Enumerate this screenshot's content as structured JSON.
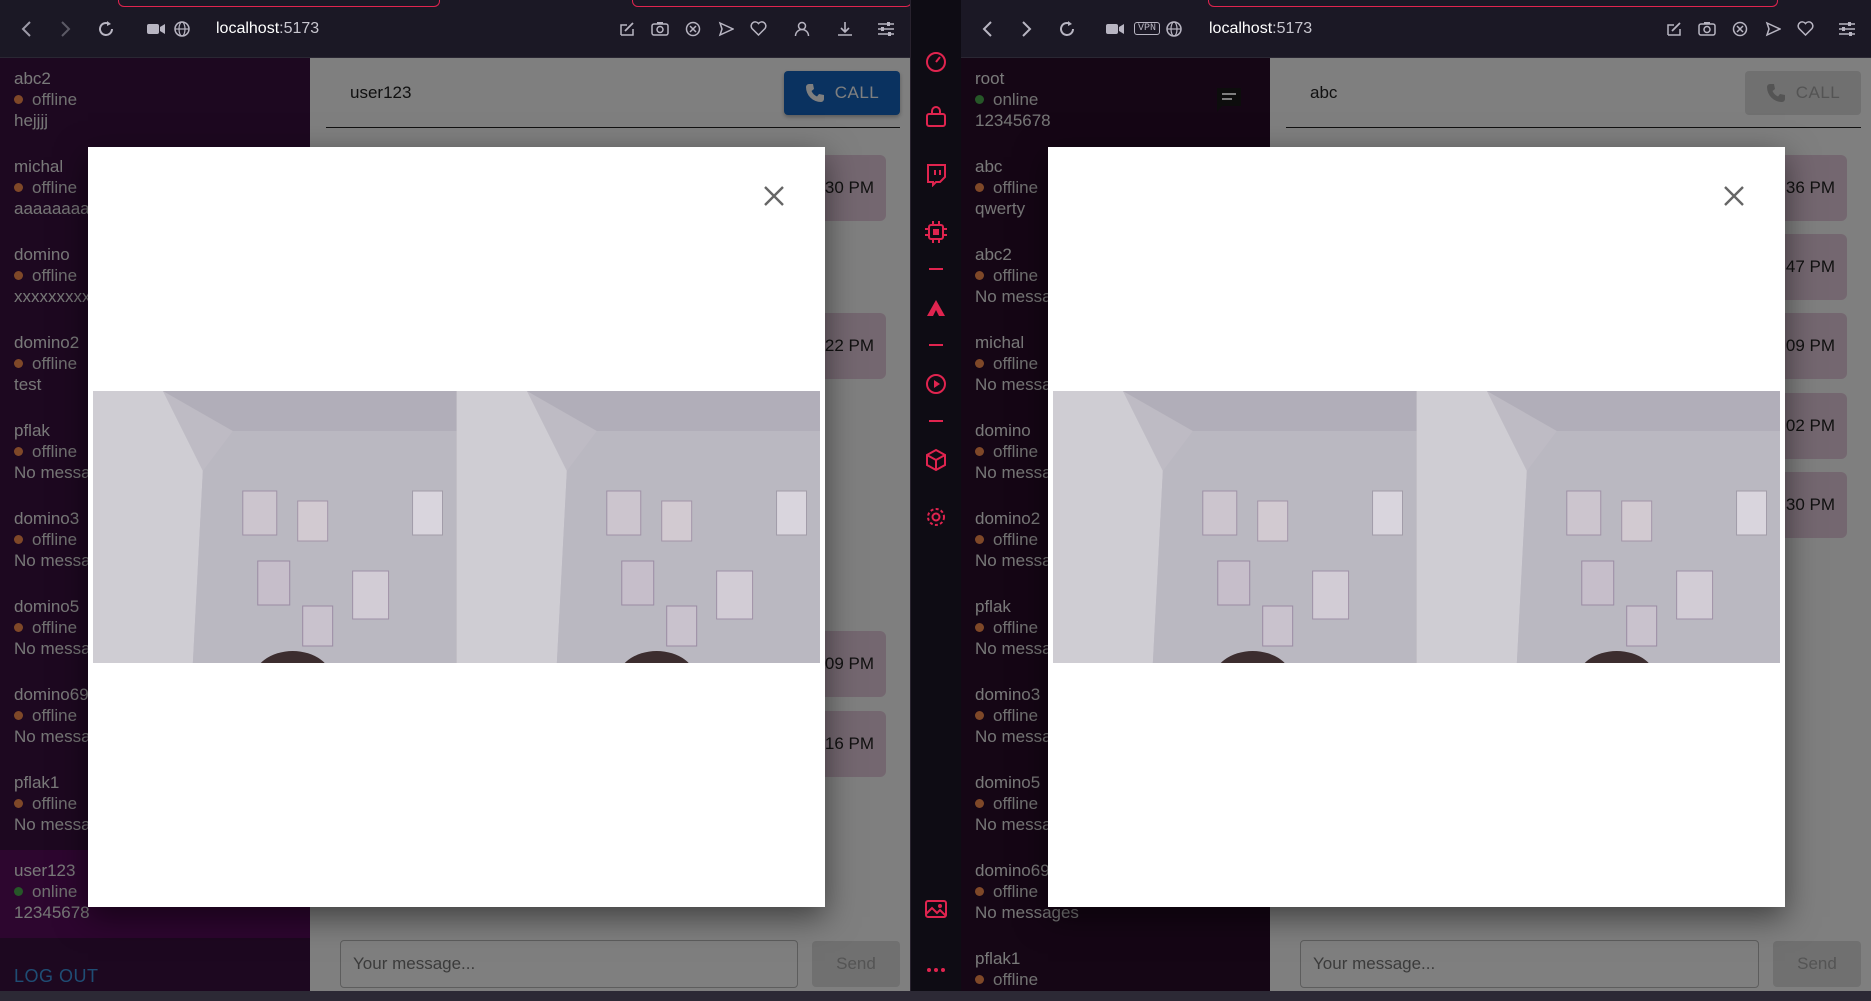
{
  "colors": {
    "accent": "#e0244f",
    "call": "#1565c0",
    "logout": "#3f9ae8",
    "bubble": "#e9cfe0",
    "online": "#4caf50",
    "offline": "#ff9050"
  },
  "left": {
    "url_host": "localhost",
    "url_port": ":5173",
    "contacts": [
      {
        "name": "abc2",
        "status": "offline",
        "last": "hejjjj"
      },
      {
        "name": "michal",
        "status": "offline",
        "last": "aaaaaaaaa"
      },
      {
        "name": "domino",
        "status": "offline",
        "last": "xxxxxxxxx"
      },
      {
        "name": "domino2",
        "status": "offline",
        "last": "test"
      },
      {
        "name": "pflak",
        "status": "offline",
        "last": "No messa"
      },
      {
        "name": "domino3",
        "status": "offline",
        "last": "No messa"
      },
      {
        "name": "domino5",
        "status": "offline",
        "last": "No messa"
      },
      {
        "name": "domino69",
        "status": "offline",
        "last": "No messa"
      },
      {
        "name": "pflak1",
        "status": "offline",
        "last": "No messa"
      },
      {
        "name": "user123",
        "status": "online",
        "last": "12345678"
      }
    ],
    "logout": "LOG OUT",
    "chat_title": "user123",
    "call_label": "CALL",
    "times": [
      "30 PM",
      "22 PM",
      "09 PM",
      "16 PM"
    ],
    "message_placeholder": "Your message...",
    "send_label": "Send"
  },
  "right": {
    "url_host": "localhost",
    "url_port": ":5173",
    "vpn": "VPN",
    "contacts": [
      {
        "name": "root",
        "status": "online",
        "last": "12345678"
      },
      {
        "name": "abc",
        "status": "offline",
        "last": "qwerty"
      },
      {
        "name": "abc2",
        "status": "offline",
        "last": "No messa"
      },
      {
        "name": "michal",
        "status": "offline",
        "last": "No messa"
      },
      {
        "name": "domino",
        "status": "offline",
        "last": "No messa"
      },
      {
        "name": "domino2",
        "status": "offline",
        "last": "No messa"
      },
      {
        "name": "pflak",
        "status": "offline",
        "last": "No messa"
      },
      {
        "name": "domino3",
        "status": "offline",
        "last": "No messa"
      },
      {
        "name": "domino5",
        "status": "offline",
        "last": "No messa"
      },
      {
        "name": "domino69",
        "status": "offline",
        "last": "No messages"
      },
      {
        "name": "pflak1",
        "status": "offline",
        "last": ""
      }
    ],
    "chat_title": "abc",
    "call_label": "CALL",
    "times": [
      "36 PM",
      "47 PM",
      "09 PM",
      "02 PM",
      "30 PM"
    ],
    "message_placeholder": "Your message...",
    "send_label": "Send"
  },
  "modal": {
    "close": "×"
  },
  "icons": {
    "nav": [
      "back-icon",
      "forward-icon",
      "reload-icon",
      "video-icon",
      "globe-icon"
    ],
    "toolbar_right_left": [
      "edit-icon",
      "camera-icon",
      "shield-icon",
      "send-icon",
      "heart-icon",
      "profile-icon",
      "download-icon",
      "settings-icon"
    ],
    "toolbar_right_right": [
      "edit-icon",
      "camera-icon",
      "shield-icon",
      "send-icon",
      "heart-icon",
      "settings-icon"
    ],
    "strip": [
      "speed-dial-icon",
      "shopping-icon",
      "twitch-icon",
      "chip-icon",
      "aria-icon",
      "player-icon",
      "cube-icon",
      "settings-icon",
      "image-icon",
      "more-icon"
    ]
  }
}
